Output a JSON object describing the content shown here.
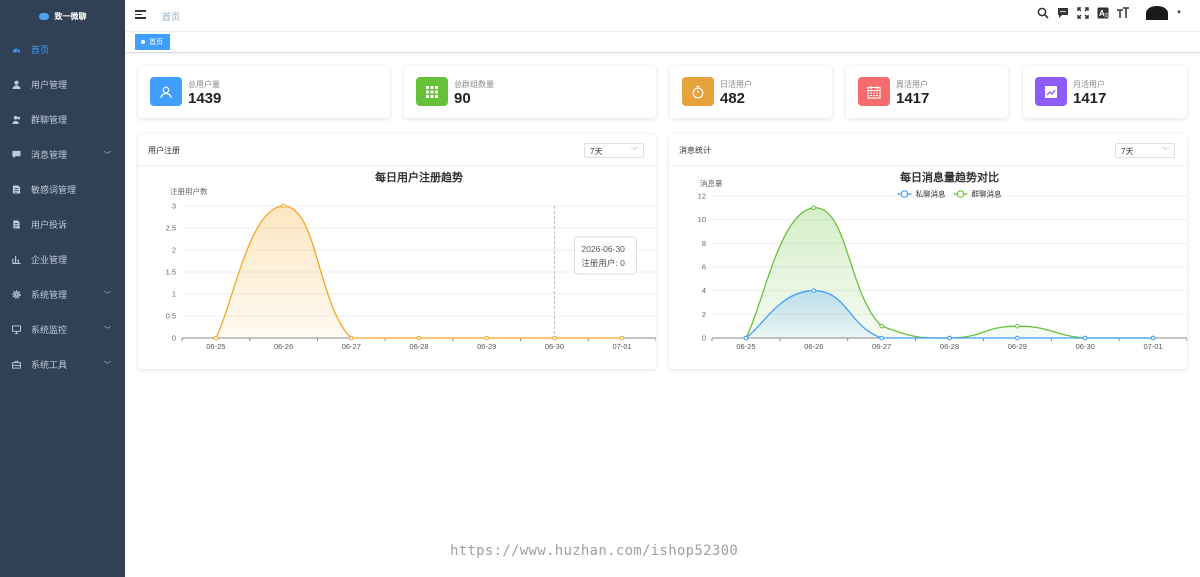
{
  "sidebar": {
    "logo_text": "致一微聊",
    "items": [
      {
        "label": "首页",
        "icon": "dashboard-icon",
        "active": true,
        "has_children": false
      },
      {
        "label": "用户管理",
        "icon": "user-icon",
        "active": false,
        "has_children": false
      },
      {
        "label": "群聊管理",
        "icon": "group-icon",
        "active": false,
        "has_children": false
      },
      {
        "label": "消息管理",
        "icon": "message-icon",
        "active": false,
        "has_children": true
      },
      {
        "label": "敏感词管理",
        "icon": "document-icon",
        "active": false,
        "has_children": false
      },
      {
        "label": "用户投诉",
        "icon": "complaint-icon",
        "active": false,
        "has_children": false
      },
      {
        "label": "企业管理",
        "icon": "building-icon",
        "active": false,
        "has_children": false
      },
      {
        "label": "系统管理",
        "icon": "gear-icon",
        "active": false,
        "has_children": true
      },
      {
        "label": "系统监控",
        "icon": "monitor-icon",
        "active": false,
        "has_children": true
      },
      {
        "label": "系统工具",
        "icon": "toolbox-icon",
        "active": false,
        "has_children": true
      }
    ]
  },
  "header": {
    "breadcrumb": "首页",
    "icons": [
      "search-icon",
      "chat-icon",
      "fullscreen-icon",
      "translate-icon",
      "font-size-icon"
    ]
  },
  "tags": [
    {
      "label": "首页",
      "active": true
    }
  ],
  "stats": [
    {
      "label": "总用户量",
      "value": "1439",
      "color": "#409eff",
      "icon": "user-outline-icon"
    },
    {
      "label": "总群组数量",
      "value": "90",
      "color": "#67c23a",
      "icon": "grid-icon"
    },
    {
      "label": "日活用户",
      "value": "482",
      "color": "#e6a23c",
      "icon": "stopwatch-icon"
    },
    {
      "label": "周活用户",
      "value": "1417",
      "color": "#f56c6c",
      "icon": "calendar-icon"
    },
    {
      "label": "月活用户",
      "value": "1417",
      "color": "#8b5cf6",
      "icon": "trend-icon"
    }
  ],
  "panels": {
    "register": {
      "title": "用户注册",
      "range": "7天"
    },
    "message": {
      "title": "消息统计",
      "range": "7天"
    }
  },
  "chart_data": [
    {
      "type": "area",
      "title": "每日用户注册趋势",
      "ylabel": "注册用户数",
      "x": [
        "06-25",
        "06-26",
        "06-27",
        "06-28",
        "06-29",
        "06-30",
        "07-01"
      ],
      "ylim": [
        0,
        3
      ],
      "yticks": [
        "0",
        "0.5",
        "1",
        "1.5",
        "2",
        "2.5",
        "3"
      ],
      "series": [
        {
          "values": [
            0,
            3,
            0,
            0,
            0,
            0,
            0
          ],
          "color": "#f5a623"
        }
      ],
      "tooltip": {
        "x": "2026-06-30",
        "text": "注册用户: 0"
      }
    },
    {
      "type": "area",
      "title": "每日消息量趋势对比",
      "ylabel": "消息量",
      "x": [
        "06-25",
        "06-26",
        "06-27",
        "06-28",
        "06-29",
        "06-30",
        "07-01"
      ],
      "ylim": [
        0,
        12
      ],
      "yticks": [
        "0",
        "2",
        "4",
        "6",
        "8",
        "10",
        "12"
      ],
      "legend_position": "top-center",
      "series": [
        {
          "name": "私聊消息",
          "values": [
            0,
            4,
            0,
            0,
            0,
            0,
            0
          ],
          "color": "#409eff"
        },
        {
          "name": "群聊消息",
          "values": [
            0,
            11,
            1,
            0,
            1,
            0,
            0
          ],
          "color": "#67c23a"
        }
      ]
    }
  ],
  "watermark": "https://www.huzhan.com/ishop52300"
}
